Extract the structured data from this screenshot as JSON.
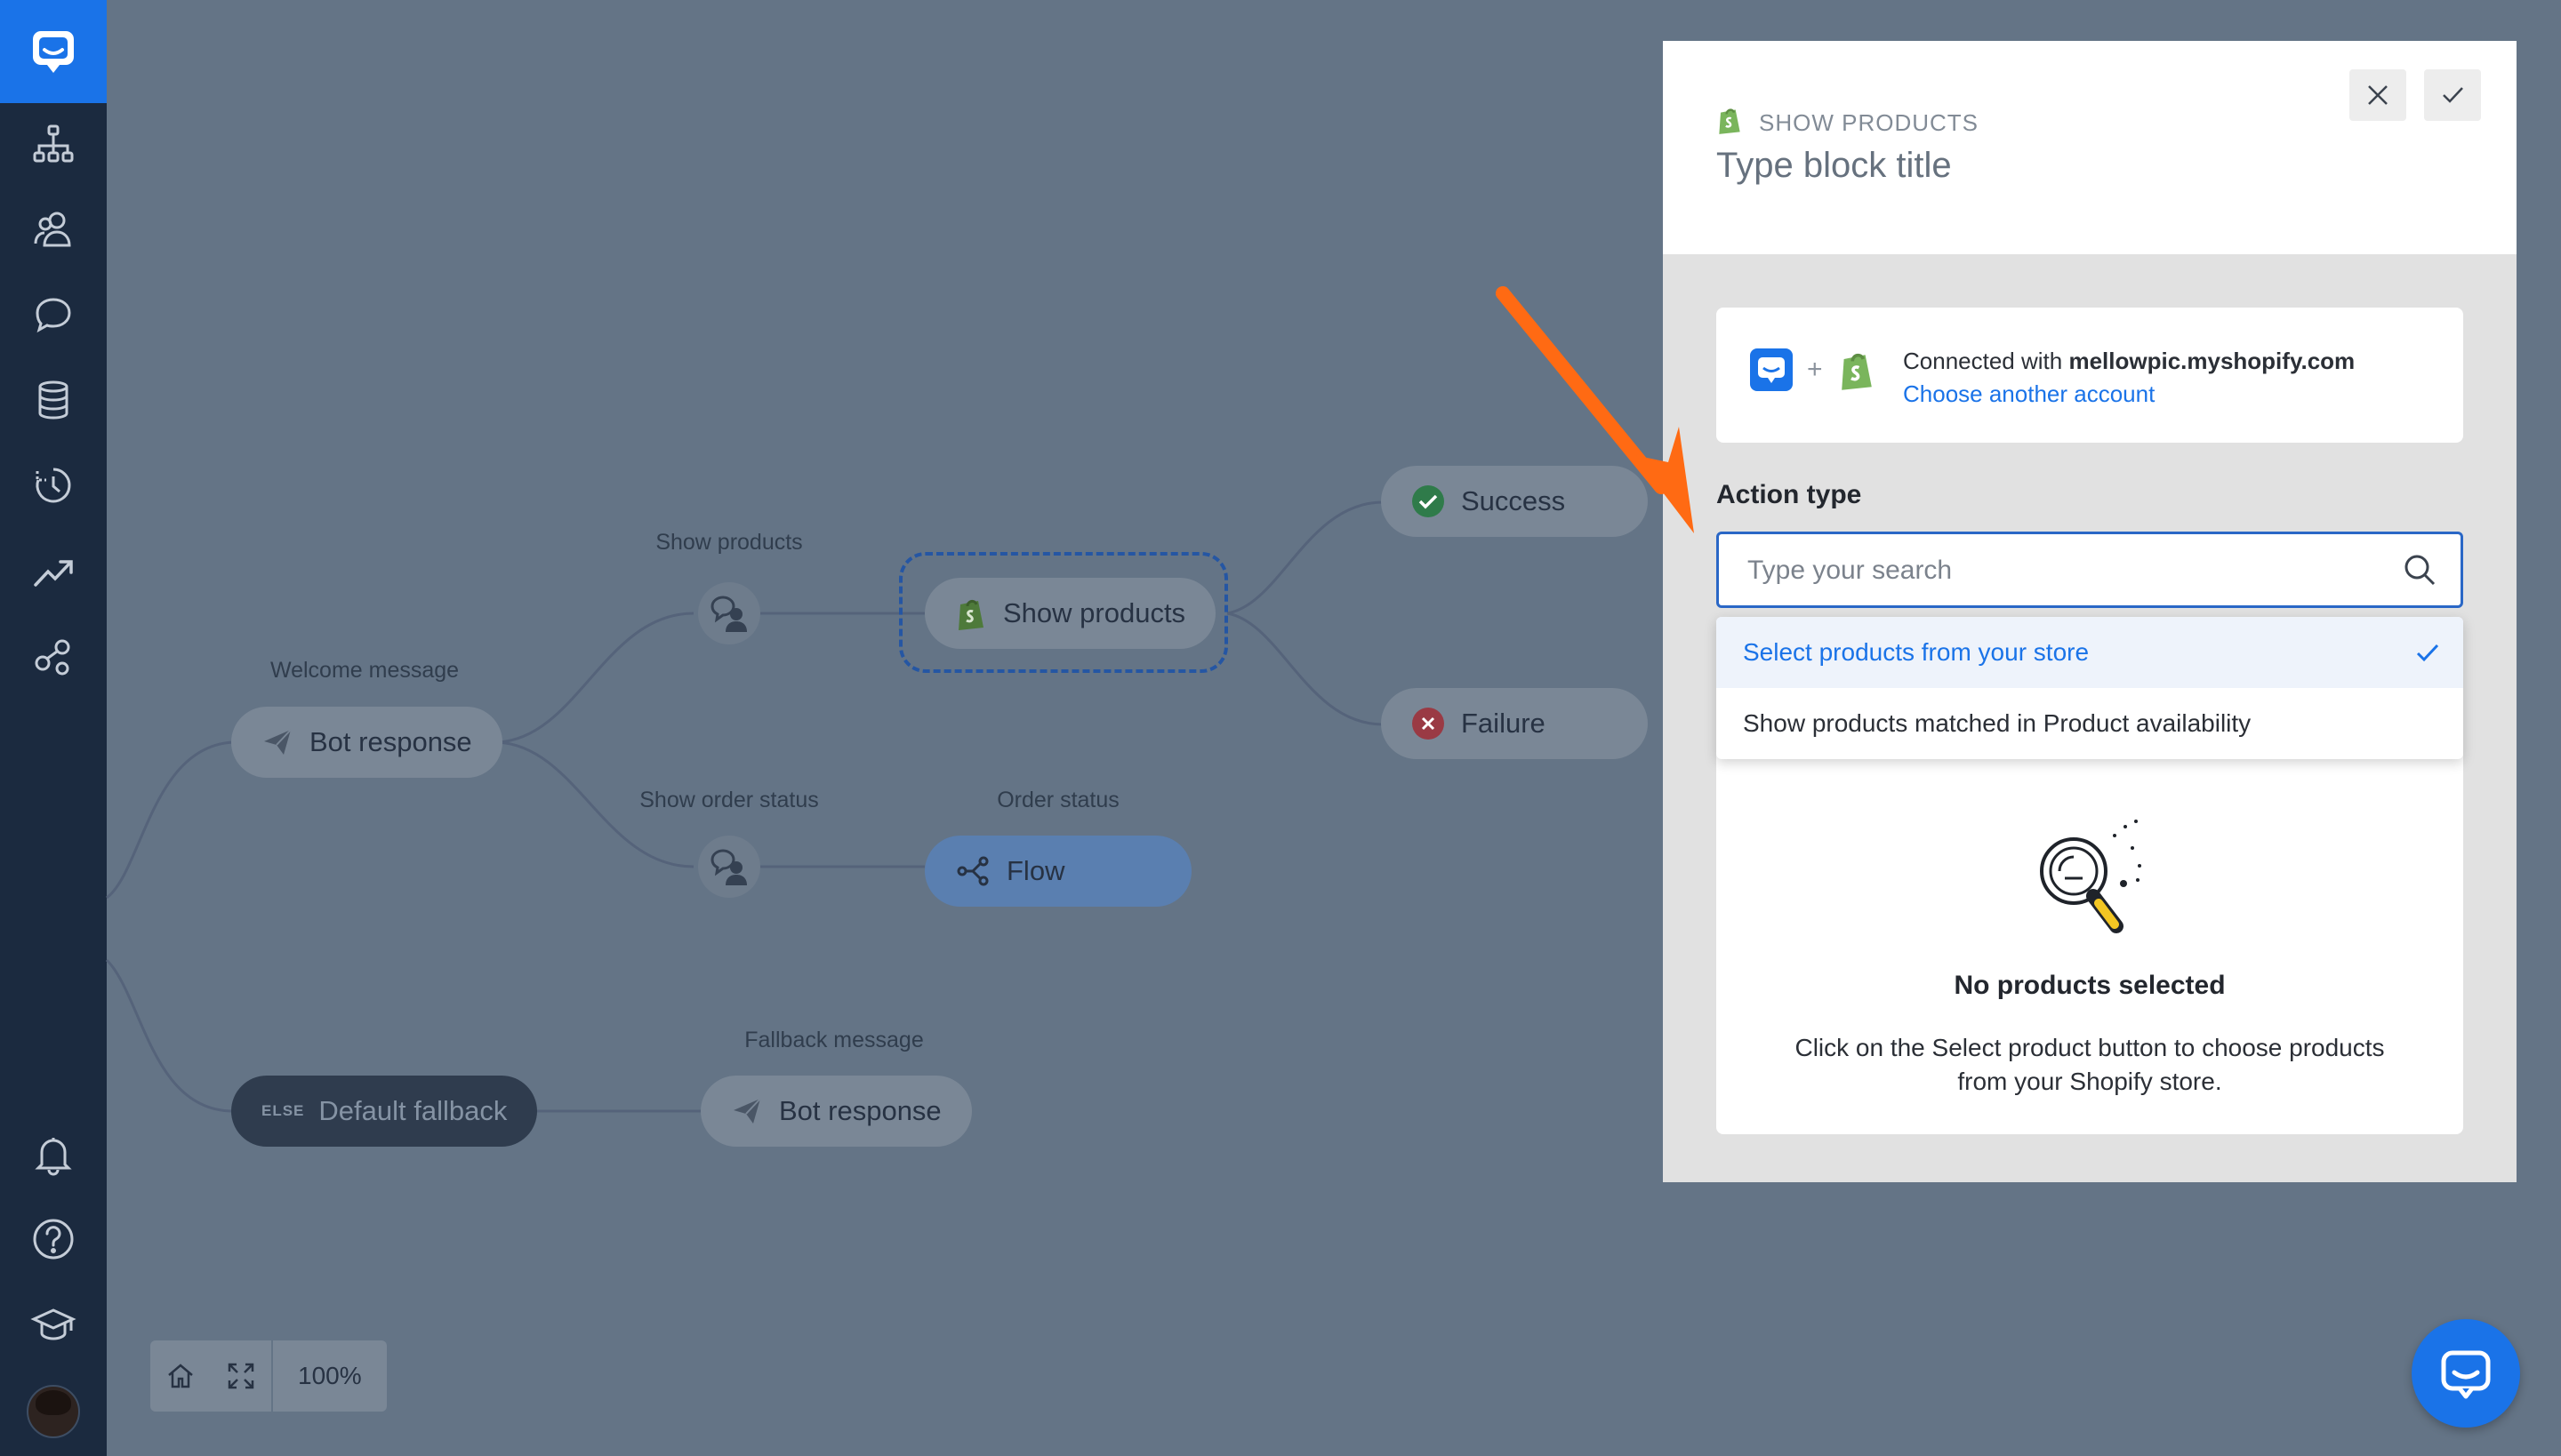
{
  "colors": {
    "accent": "#1a73e8",
    "sidebar": "#1b2a3f",
    "overlay": "#647486",
    "annotation_arrow": "#ff6a13"
  },
  "sidebar": {
    "items": [
      {
        "icon": "logo-chat-icon"
      },
      {
        "icon": "sitemap-icon"
      },
      {
        "icon": "users-icon"
      },
      {
        "icon": "chat-bubble-icon"
      },
      {
        "icon": "database-icon"
      },
      {
        "icon": "history-icon"
      },
      {
        "icon": "trending-up-icon"
      },
      {
        "icon": "integrations-icon"
      }
    ],
    "bottom_items": [
      {
        "icon": "bell-icon"
      },
      {
        "icon": "help-icon"
      },
      {
        "icon": "graduation-cap-icon"
      },
      {
        "icon": "user-avatar"
      }
    ]
  },
  "canvas": {
    "nodes": {
      "welcome_label": "Welcome message",
      "welcome_bot": "Bot response",
      "show_products_label": "Show products",
      "show_products_block": "Show products",
      "success": "Success",
      "failure": "Failure",
      "order_status_trigger_label": "Show order status",
      "order_status_label": "Order status",
      "flow": "Flow",
      "else_tag": "ELSE",
      "default_fallback": "Default fallback",
      "fallback_label": "Fallback message",
      "fallback_bot": "Bot response"
    },
    "zoom": "100%"
  },
  "panel": {
    "type_label": "SHOW PRODUCTS",
    "title": "Type block title",
    "connection": {
      "prefix": "Connected with ",
      "store": "mellowpic.myshopify.com",
      "link": "Choose another account"
    },
    "action_type": {
      "label": "Action type",
      "placeholder": "Type your search",
      "options": [
        {
          "label": "Select products from your store",
          "selected": true
        },
        {
          "label": "Show products matched in Product availability",
          "selected": false
        }
      ]
    },
    "empty_state": {
      "title": "No products selected",
      "description": "Click on the Select product button to choose products from your Shopify store."
    }
  }
}
